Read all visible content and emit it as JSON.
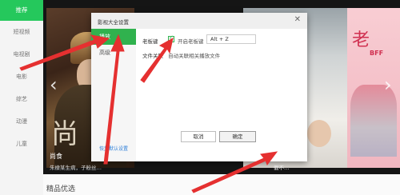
{
  "nav": {
    "items": [
      {
        "label": "推荐",
        "active": true
      },
      {
        "label": "短视频"
      },
      {
        "label": "电视剧"
      },
      {
        "label": "电影"
      },
      {
        "label": "综艺"
      },
      {
        "label": "动漫"
      },
      {
        "label": "儿童"
      }
    ]
  },
  "banner": {
    "left": {
      "bigchar": "尚",
      "caption": "尚食",
      "subcaption": "朱棣某生病，子粉丝…"
    },
    "middle": {
      "caption": "假不…"
    },
    "right": {
      "title": "老",
      "subtitle": "BFF"
    }
  },
  "bottom": {
    "label": "精品优选"
  },
  "dialog": {
    "title": "影视大全设置",
    "close_icon": "close-icon",
    "tabs": [
      {
        "label": "播放",
        "active": true
      },
      {
        "label": "高级"
      }
    ],
    "reset_link": "恢复默认设置",
    "boss_key": {
      "label": "老板键",
      "checkbox_label": "开启老板键",
      "checked": true,
      "hotkey_value": "Alt + Z"
    },
    "file_assoc": {
      "label": "文件关联",
      "link": "自动关联相关播放文件"
    },
    "buttons": {
      "cancel": "取消",
      "ok": "确定"
    }
  },
  "colors": {
    "accent_green": "#30b24e",
    "annotation_red": "#e53030"
  }
}
